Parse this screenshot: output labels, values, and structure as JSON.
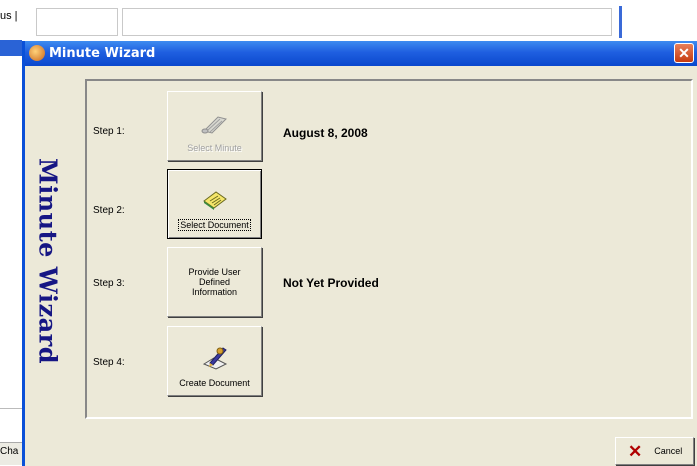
{
  "background": {
    "top_left_text": "us |",
    "bottom_left_text": "Cha"
  },
  "window": {
    "title": "Minute Wizard",
    "close_symbol": "✕",
    "sidebar_title": "Minute Wizard"
  },
  "steps": [
    {
      "label": "Step 1:",
      "button": "Select Minute",
      "status": "August  8, 2008",
      "icon": "scroll-icon",
      "state": "disabled"
    },
    {
      "label": "Step 2:",
      "button": "Select Document",
      "status": "",
      "icon": "document-icon",
      "state": "selected"
    },
    {
      "label": "Step 3:",
      "button_lines": [
        "Provide User",
        "Defined",
        "Information"
      ],
      "status": "Not Yet Provided",
      "icon": "",
      "state": "normal"
    },
    {
      "label": "Step 4:",
      "button": "Create Document",
      "status": "",
      "icon": "pen-paper-icon",
      "state": "normal"
    }
  ],
  "cancel": {
    "label": "Cancel",
    "icon": "cancel-x-icon"
  },
  "colors": {
    "title_bar": "#0a48cd",
    "sidebar_text": "#161684",
    "cancel_icon": "#b00000"
  }
}
